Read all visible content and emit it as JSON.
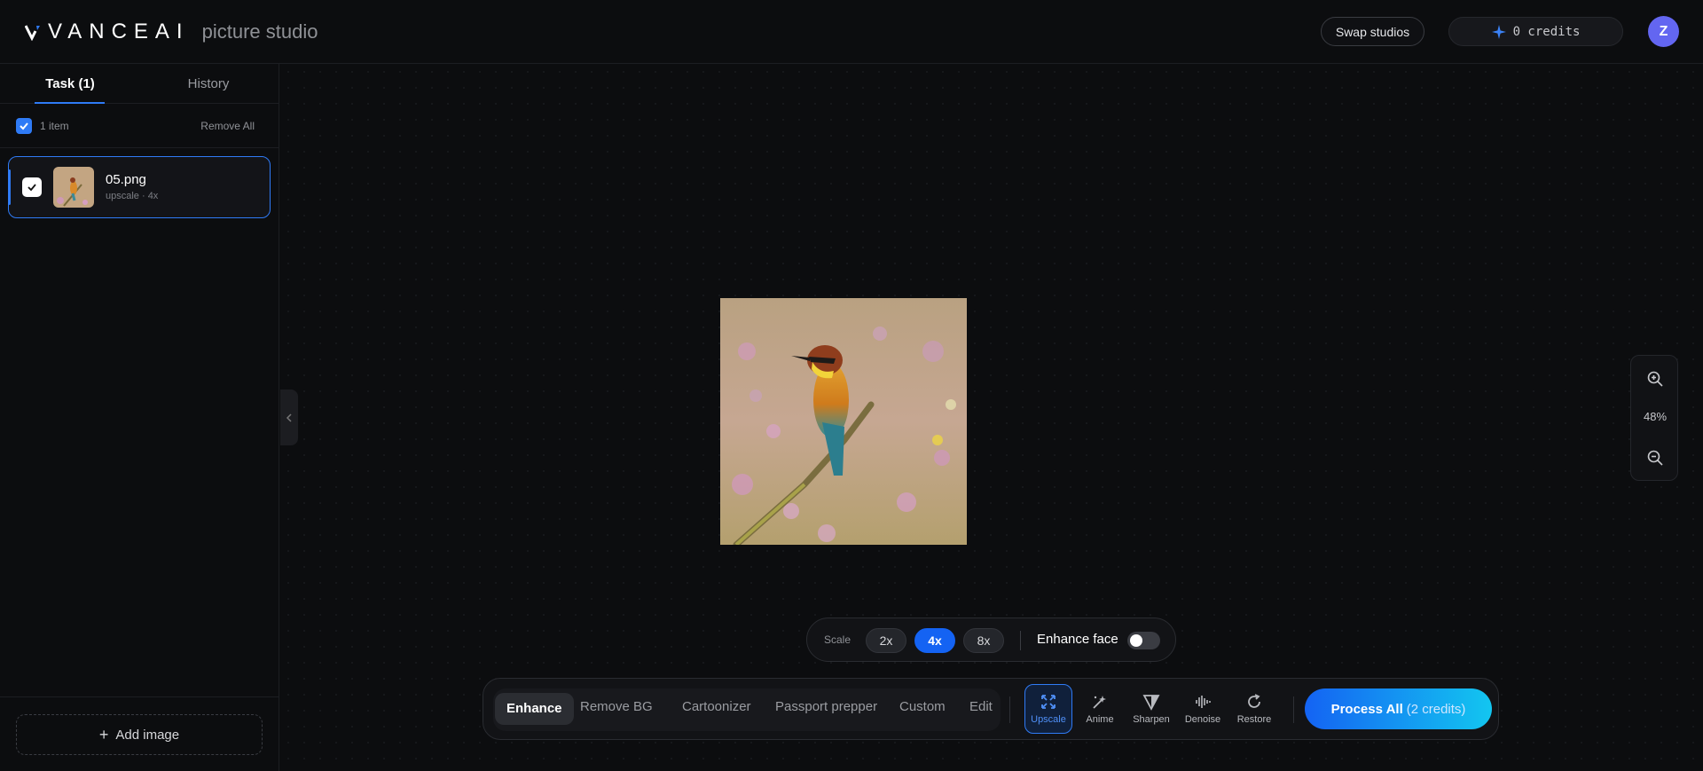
{
  "header": {
    "logo_text": "VANCEAI",
    "studio_name": "picture studio",
    "swap_label": "Swap studios",
    "credits_label": "0 credits",
    "avatar_initial": "Z",
    "accent_color": "#2f7bf6"
  },
  "sidebar": {
    "tabs": [
      {
        "label": "Task (1)",
        "active": true
      },
      {
        "label": "History",
        "active": false
      }
    ],
    "items_count": "1 item",
    "remove_all": "Remove All",
    "tasks": [
      {
        "name": "05.png",
        "meta": "upscale · 4x",
        "checked": true
      }
    ],
    "add_image": "Add image"
  },
  "canvas": {
    "zoom_level": "48%"
  },
  "scale_bar": {
    "label": "Scale",
    "options": [
      "2x",
      "4x",
      "8x"
    ],
    "selected": "4x",
    "enhance_face_label": "Enhance face",
    "enhance_face_on": false
  },
  "toolbar": {
    "modes": [
      "Enhance",
      "Remove BG",
      "Cartoonizer",
      "Passport prepper",
      "Custom",
      "Edit"
    ],
    "active_mode": "Enhance",
    "tools": [
      {
        "label": "Upscale",
        "icon": "expand-arrows-icon",
        "active": true
      },
      {
        "label": "Anime",
        "icon": "magic-wand-icon",
        "active": false
      },
      {
        "label": "Sharpen",
        "icon": "triangle-icon",
        "active": false
      },
      {
        "label": "Denoise",
        "icon": "waveform-icon",
        "active": false
      },
      {
        "label": "Restore",
        "icon": "refresh-icon",
        "active": false
      }
    ],
    "process_label": "Process All",
    "process_cost": "(2 credits)"
  }
}
